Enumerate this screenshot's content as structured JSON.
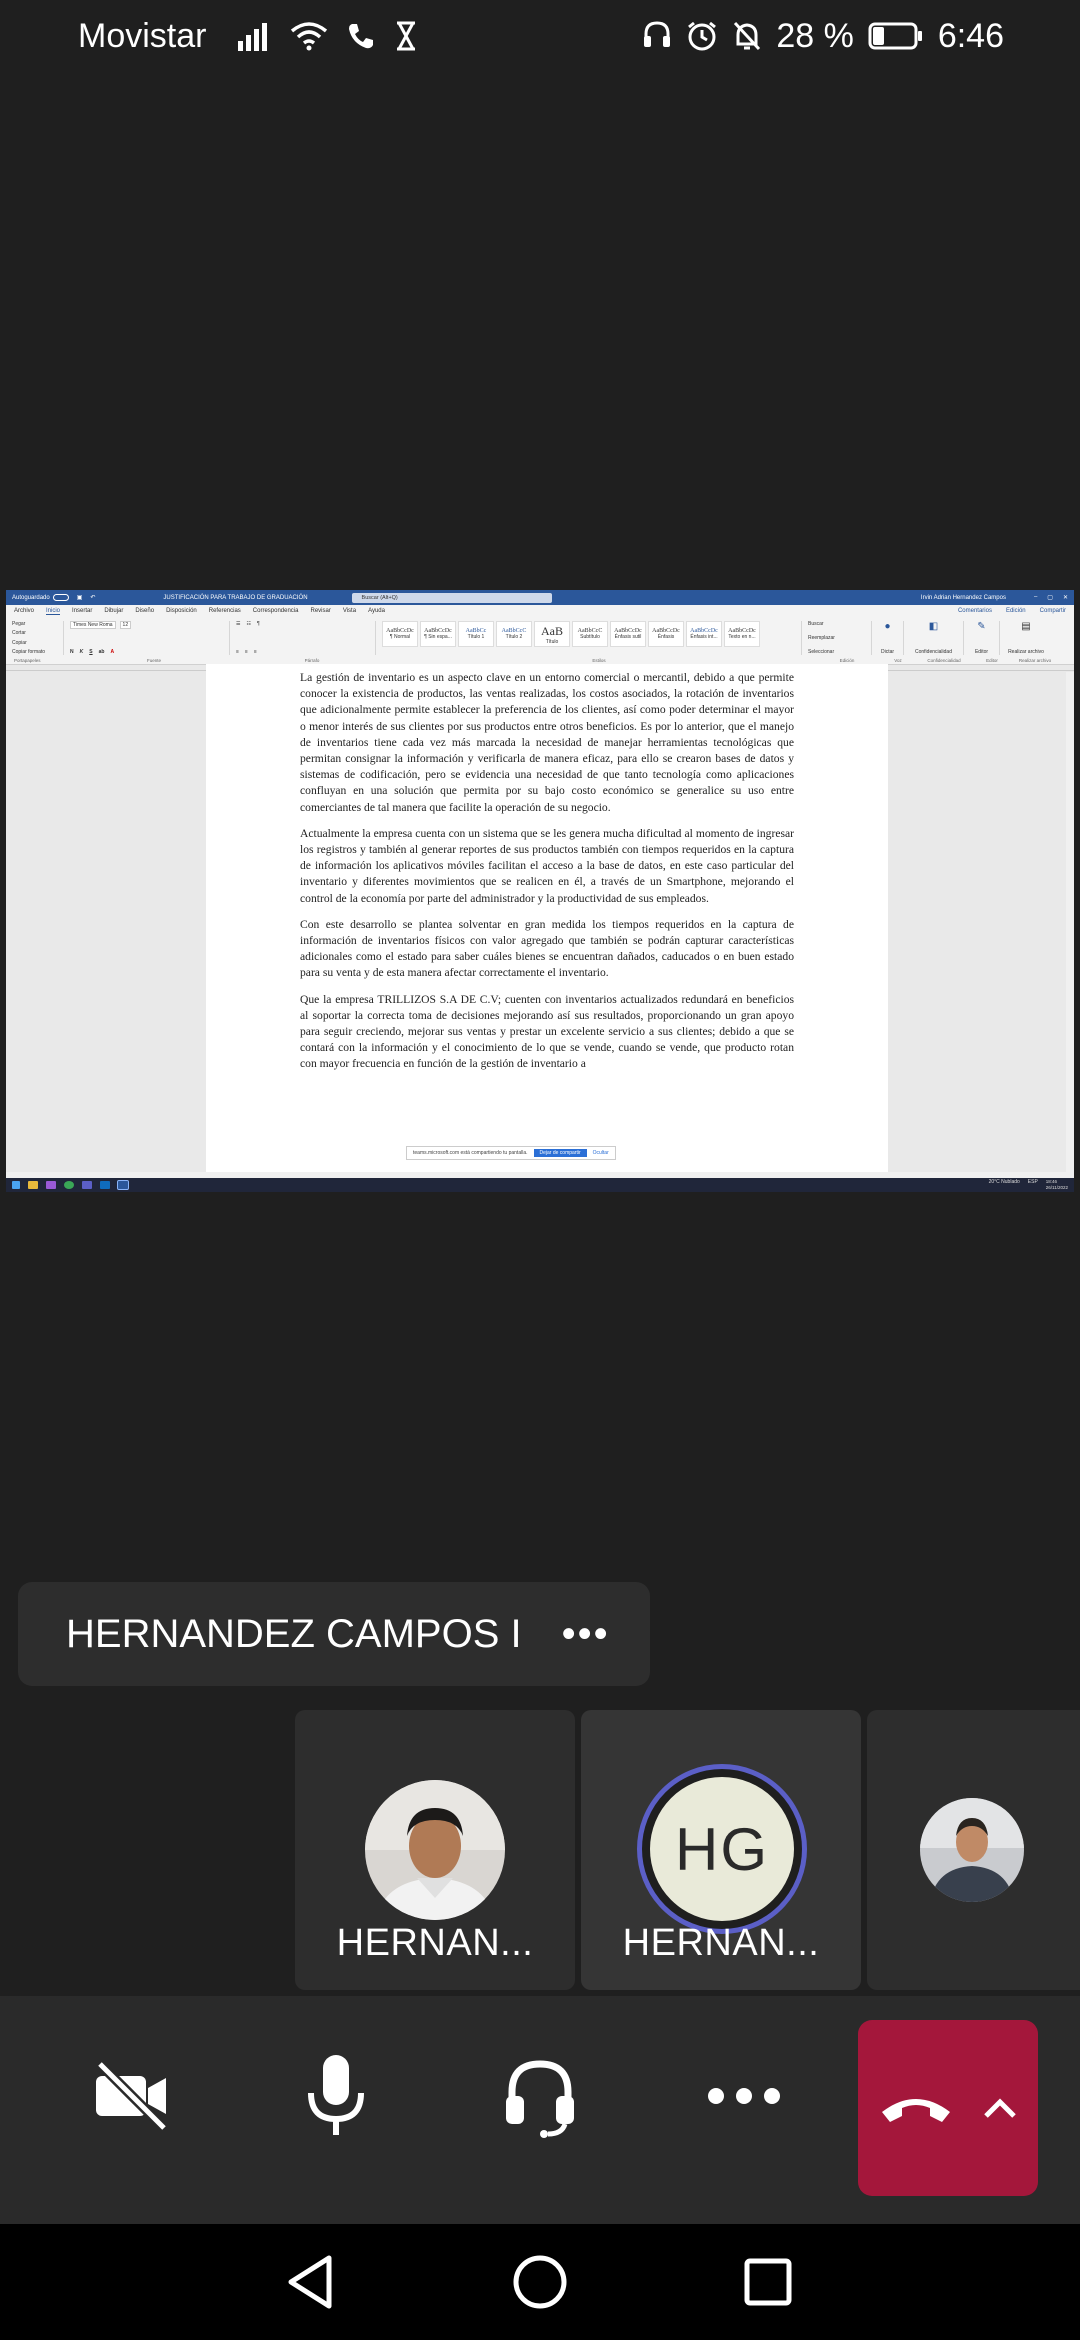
{
  "status_bar": {
    "carrier": "Movistar",
    "battery_percent": "28 %",
    "time": "6:46",
    "icons": [
      "signal-icon",
      "wifi-icon",
      "call-icon",
      "hourglass-icon",
      "headset-icon",
      "alarm-icon",
      "notifications-off-icon",
      "battery-icon"
    ]
  },
  "shared_screen": {
    "word": {
      "autosave_label": "Autoguardado",
      "doc_title": "JUSTIFICACIÓN PARA TRABAJO DE GRADUACIÓN",
      "search_placeholder": "Buscar (Alt+Q)",
      "user_name": "Irvin Adrian Hernandez Campos",
      "tabs": [
        "Archivo",
        "Inicio",
        "Insertar",
        "Dibujar",
        "Diseño",
        "Disposición",
        "Referencias",
        "Correspondencia",
        "Revisar",
        "Vista",
        "Ayuda"
      ],
      "active_tab": "Inicio",
      "comments_label": "Comentarios",
      "editing_label": "Edición",
      "share_label": "Compartir",
      "font_name": "Times New Roma",
      "font_size": "12",
      "clipboard": {
        "paste": "Pegar",
        "cut": "Cortar",
        "copy": "Copiar",
        "format": "Copiar formato"
      },
      "styles": [
        {
          "sample": "AaBbCcDc",
          "name": "¶ Normal"
        },
        {
          "sample": "AaBbCcDc",
          "name": "¶ Sin espa..."
        },
        {
          "sample": "AaBbCc",
          "name": "Título 1"
        },
        {
          "sample": "AaBbCcC",
          "name": "Título 2"
        },
        {
          "sample": "AaB",
          "name": "Título"
        },
        {
          "sample": "AaBbCcC",
          "name": "Subtítulo"
        },
        {
          "sample": "AaBbCcDc",
          "name": "Énfasis sutil"
        },
        {
          "sample": "AaBbCcDc",
          "name": "Énfasis"
        },
        {
          "sample": "AaBbCcDc",
          "name": "Énfasis int..."
        },
        {
          "sample": "AaBbCcDc",
          "name": "Texto en n..."
        }
      ],
      "editing_tools": [
        "Buscar",
        "Reemplazar",
        "Seleccionar"
      ],
      "right_tools": [
        "Dictar",
        "Confidencialidad",
        "Editor",
        "Realizar archivo"
      ],
      "group_labels": [
        "Portapapeles",
        "Fuente",
        "Párrafo",
        "Estilos",
        "Edición",
        "Voz",
        "Confidencialidad",
        "Editor",
        "Realizar archivo"
      ],
      "paragraphs": [
        "La gestión de inventario es un aspecto clave en un entorno comercial o mercantil, debido a que permite conocer la existencia de productos, las ventas realizadas, los costos asociados, la rotación de inventarios que adicionalmente permite establecer la preferencia de los clientes, así como poder determinar el mayor o menor interés de sus clientes por sus productos entre otros beneficios. Es por lo anterior, que el manejo de inventarios tiene cada vez más marcada la necesidad de manejar herramientas tecnológicas que permitan consignar la información y verificarla de manera eficaz, para ello se crearon bases de datos y sistemas de codificación, pero se evidencia una necesidad de que tanto tecnología como aplicaciones confluyan en una solución que permita por su bajo costo económico se generalice su uso entre comerciantes de tal manera que facilite la operación de su negocio.",
        "Actualmente la empresa cuenta con un sistema que se les genera mucha dificultad al momento de ingresar los registros y también al generar reportes de sus productos también con tiempos requeridos en la captura de información  los aplicativos móviles facilitan el acceso a la base de datos, en este caso particular del inventario y diferentes movimientos que se realicen en él, a través de un Smartphone, mejorando el control de la economía por parte del administrador y la productividad de sus empleados.",
        "Con este desarrollo se plantea solventar en gran medida los tiempos requeridos en la captura de información de inventarios físicos con valor agregado que también se podrán capturar características adicionales como el estado para saber cuáles bienes se encuentran dañados, caducados o en buen estado para su venta y de esta manera afectar correctamente el inventario.",
        "Que la empresa TRILLIZOS S.A DE C.V; cuenten con inventarios actualizados redundará en beneficios al soportar la correcta toma de decisiones mejorando así sus resultados, proporcionando un gran apoyo para seguir creciendo, mejorar sus ventas y prestar un excelente servicio a sus clientes; debido a que se contará con la información y el conocimiento de lo que se vende, cuando se vende, que producto rotan con mayor frecuencia en función de la gestión de inventario a"
      ],
      "share_banner": {
        "text": "teams.microsoft.com está compartiendo tu pantalla.",
        "stop": "Dejar de compartir",
        "hide": "Ocultar"
      },
      "taskbar": {
        "weather": "20°C  Nublado",
        "lang": "ESP",
        "clock_time": "18:46",
        "clock_date": "26/11/2022"
      }
    }
  },
  "participant_card": {
    "name": "HERNANDEZ CAMPOS I",
    "more": "•••"
  },
  "tiles": [
    {
      "name": "HERNAN..."
    },
    {
      "name": "HERNAN...",
      "initials": "HG"
    },
    {
      "name": ""
    }
  ],
  "colors": {
    "background": "#1f1f1f",
    "hangup": "#a4173b",
    "avatar_ring": "#5b5fc7",
    "word_blue": "#2b579a"
  }
}
